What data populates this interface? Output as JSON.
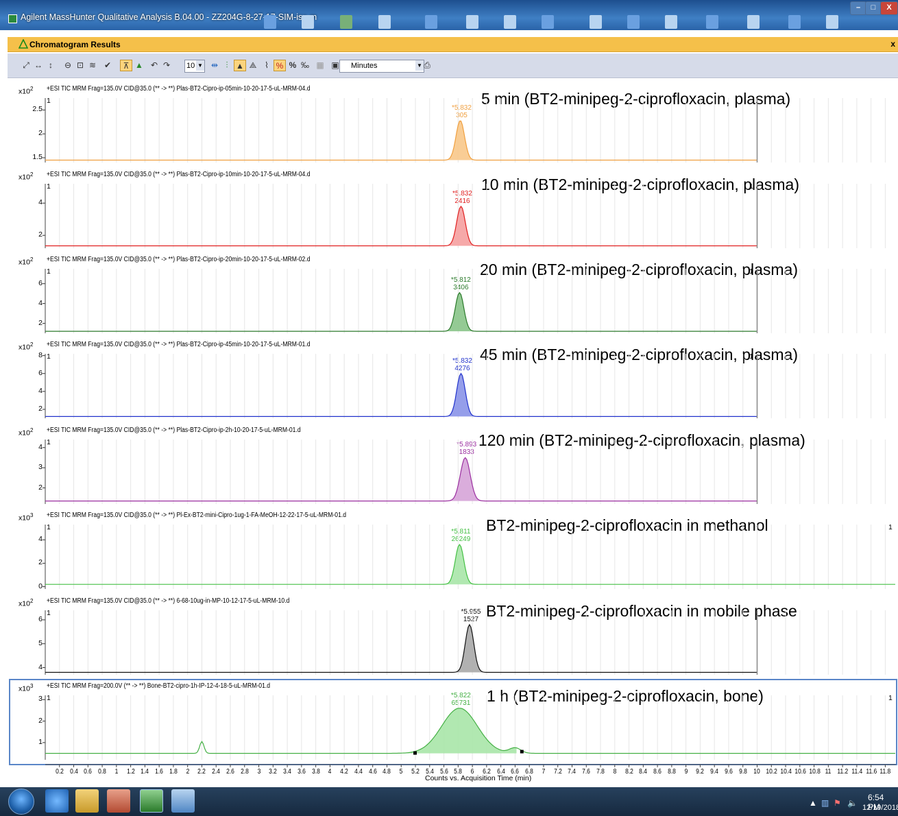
{
  "window": {
    "title": "Agilent MassHunter Qualitative Analysis B.04.00 - ZZ204G-8-27-17-SIM-iso.m",
    "minimize": "–",
    "maximize": "□",
    "close": "X"
  },
  "panel": {
    "title": "Chromatogram Results",
    "close": "x"
  },
  "toolbar": {
    "zoom_value": "10",
    "units_value": "Minutes"
  },
  "chromatograms": [
    {
      "multiplier": "x10",
      "exp": "2",
      "trace": "+ESI TIC MRM Frag=135.0V CID@35.0 (** -> **) Plas-BT2-Cipro-ip-05min-10-20-17-5-uL-MRM-04.d",
      "annotation": "5 min (BT2-minipeg-2-ciprofloxacin, plasma)",
      "y_ticks": [
        "2.5",
        "2",
        "1.5"
      ],
      "y_vals": [
        2.5,
        2,
        1.5
      ],
      "y_range": [
        1.4,
        2.75
      ],
      "baseline": 1.45,
      "peak_rt": "5.832",
      "peak_area": "305",
      "apex_x": 5.83,
      "apex_y": 2.28,
      "sigma": 0.06,
      "color": "#f0a040",
      "fill": "#f8c88a",
      "show_right_one": false
    },
    {
      "multiplier": "x10",
      "exp": "2",
      "trace": "+ESI TIC MRM Frag=135.0V CID@35.0 (** -> **) Plas-BT2-Cipro-ip-10min-10-20-17-5-uL-MRM-04.d",
      "annotation": "10 min (BT2-minipeg-2-ciprofloxacin, plasma)",
      "y_ticks": [
        "4",
        "2"
      ],
      "y_vals": [
        4,
        2
      ],
      "y_range": [
        1.2,
        5.2
      ],
      "baseline": 1.35,
      "peak_rt": "5.832",
      "peak_area": "2416",
      "apex_x": 5.84,
      "apex_y": 3.8,
      "sigma": 0.06,
      "color": "#e02020",
      "fill": "#f5a0a0",
      "show_right_one": true
    },
    {
      "multiplier": "x10",
      "exp": "2",
      "trace": "+ESI TIC MRM Frag=135.0V CID@35.0 (** -> **) Plas-BT2-Cipro-ip-20min-10-20-17-5-uL-MRM-02.d",
      "annotation": "20 min (BT2-minipeg-2-ciprofloxacin, plasma)",
      "y_ticks": [
        "6",
        "4",
        "2"
      ],
      "y_vals": [
        6,
        4,
        2
      ],
      "y_range": [
        1.0,
        7.5
      ],
      "baseline": 1.2,
      "peak_rt": "5.812",
      "peak_area": "3406",
      "apex_x": 5.82,
      "apex_y": 5.1,
      "sigma": 0.06,
      "color": "#2b7a2b",
      "fill": "#88c488",
      "show_right_one": true
    },
    {
      "multiplier": "x10",
      "exp": "2",
      "trace": "+ESI TIC MRM Frag=135.0V CID@35.0 (** -> **) Plas-BT2-Cipro-ip-45min-10-20-17-5-uL-MRM-01.d",
      "annotation": "45 min (BT2-minipeg-2-ciprofloxacin, plasma)",
      "y_ticks": [
        "8",
        "6",
        "4",
        "2"
      ],
      "y_vals": [
        8,
        6,
        4,
        2
      ],
      "y_range": [
        1.0,
        8.2
      ],
      "baseline": 1.2,
      "peak_rt": "5.832",
      "peak_area": "4276",
      "apex_x": 5.84,
      "apex_y": 6.0,
      "sigma": 0.06,
      "color": "#2233cc",
      "fill": "#8a94e8",
      "show_right_one": true
    },
    {
      "multiplier": "x10",
      "exp": "2",
      "trace": "+ESI TIC MRM Frag=135.0V CID@35.0 (** -> **) Plas-BT2-Cipro-ip-2h-10-20-17-5-uL-MRM-01.d",
      "annotation": "120 min (BT2-minipeg-2-ciprofloxacin, plasma)",
      "y_ticks": [
        "4",
        "3",
        "2"
      ],
      "y_vals": [
        4,
        3,
        2
      ],
      "y_range": [
        1.2,
        4.4
      ],
      "baseline": 1.35,
      "peak_rt": "5.893",
      "peak_area": "1833",
      "apex_x": 5.9,
      "apex_y": 3.5,
      "sigma": 0.07,
      "color": "#9b2fa0",
      "fill": "#d6a4d8",
      "show_right_one": false
    },
    {
      "multiplier": "x10",
      "exp": "3",
      "trace": "+ESI TIC MRM Frag=135.0V CID@35.0 (** -> **) Pl-Ex-BT2-mini-Cipro-1ug-1-FA-MeOH-12-22-17-5-uL-MRM-01.d",
      "annotation": "BT2-minipeg-2-ciprofloxacin in methanol",
      "y_ticks": [
        "4",
        "2",
        "0"
      ],
      "y_vals": [
        4,
        2,
        0
      ],
      "y_range": [
        -0.2,
        5.3
      ],
      "baseline": 0.2,
      "peak_rt": "5.811",
      "peak_area": "26249",
      "apex_x": 5.82,
      "apex_y": 3.6,
      "sigma": 0.06,
      "color": "#45c045",
      "fill": "#a8e6a8",
      "show_right_one": true
    },
    {
      "multiplier": "x10",
      "exp": "2",
      "trace": "+ESI TIC MRM Frag=135.0V CID@35.0 (** -> **) 6-68-10ug-in-MP-10-12-17-5-uL-MRM-10.d",
      "annotation": "BT2-minipeg-2-ciprofloxacin in mobile phase",
      "y_ticks": [
        "6",
        "5",
        "4"
      ],
      "y_vals": [
        6,
        5,
        4
      ],
      "y_range": [
        3.7,
        6.4
      ],
      "baseline": 3.8,
      "peak_rt": "5.955",
      "peak_area": "1527",
      "apex_x": 5.96,
      "apex_y": 5.8,
      "sigma": 0.06,
      "color": "#111111",
      "fill": "#a8a8a8",
      "show_right_one": false
    },
    {
      "multiplier": "x10",
      "exp": "3",
      "trace": "+ESI TIC MRM Frag=200.0V (** -> **) Bone-BT2-cipro-1h-IP-12-4-18-5-uL-MRM-01.d",
      "annotation": "1 h (BT2-minipeg-2-ciprofloxacin, bone)",
      "y_ticks": [
        "3",
        "2",
        "1"
      ],
      "y_vals": [
        3,
        2,
        1
      ],
      "y_range": [
        0.2,
        3.2
      ],
      "baseline": 0.5,
      "peak_rt": "5.822",
      "peak_area": "65731",
      "apex_x": 5.82,
      "apex_y": 2.6,
      "sigma": 0.25,
      "color": "#45b045",
      "fill": "#a8e6a8",
      "show_right_one": true
    }
  ],
  "x_axis": {
    "label": "Counts vs. Acquisition Time (min)",
    "ticks": [
      "0.2",
      "0.4",
      "0.6",
      "0.8",
      "1",
      "1.2",
      "1.4",
      "1.6",
      "1.8",
      "2",
      "2.2",
      "2.4",
      "2.6",
      "2.8",
      "3",
      "3.2",
      "3.4",
      "3.6",
      "3.8",
      "4",
      "4.2",
      "4.4",
      "4.6",
      "4.8",
      "5",
      "5.2",
      "5.4",
      "5.6",
      "5.8",
      "6",
      "6.2",
      "6.4",
      "6.6",
      "6.8",
      "7",
      "7.2",
      "7.4",
      "7.6",
      "7.8",
      "8",
      "8.2",
      "8.4",
      "8.6",
      "8.8",
      "9",
      "9.2",
      "9.4",
      "9.6",
      "9.8",
      "10",
      "10.2",
      "10.4",
      "10.6",
      "10.8",
      "11",
      "11.2",
      "11.4",
      "11.6",
      "11.8"
    ],
    "range": [
      0,
      11.95
    ]
  },
  "gutter_one": "1",
  "taskbar": {
    "time": "6:54 PM",
    "date": "12/19/2018"
  }
}
